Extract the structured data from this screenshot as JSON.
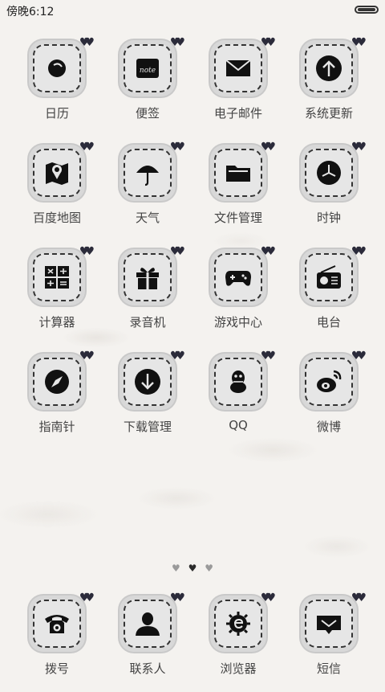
{
  "status": {
    "time": "傍晚6:12"
  },
  "apps": [
    {
      "label": "日历",
      "icon": "calendar-icon"
    },
    {
      "label": "便签",
      "icon": "notes-icon"
    },
    {
      "label": "电子邮件",
      "icon": "mail-icon"
    },
    {
      "label": "系统更新",
      "icon": "update-icon"
    },
    {
      "label": "百度地图",
      "icon": "map-icon"
    },
    {
      "label": "天气",
      "icon": "umbrella-icon"
    },
    {
      "label": "文件管理",
      "icon": "folder-icon"
    },
    {
      "label": "时钟",
      "icon": "clock-icon"
    },
    {
      "label": "计算器",
      "icon": "calculator-icon"
    },
    {
      "label": "录音机",
      "icon": "gift-icon"
    },
    {
      "label": "游戏中心",
      "icon": "gamepad-icon"
    },
    {
      "label": "电台",
      "icon": "radio-icon"
    },
    {
      "label": "指南针",
      "icon": "compass-icon"
    },
    {
      "label": "下载管理",
      "icon": "download-icon"
    },
    {
      "label": "QQ",
      "icon": "qq-icon"
    },
    {
      "label": "微博",
      "icon": "weibo-icon"
    }
  ],
  "dock": [
    {
      "label": "拨号",
      "icon": "phone-icon"
    },
    {
      "label": "联系人",
      "icon": "contact-icon"
    },
    {
      "label": "浏览器",
      "icon": "browser-icon"
    },
    {
      "label": "短信",
      "icon": "message-icon"
    }
  ],
  "pager": {
    "pages": 3,
    "active": 1
  }
}
